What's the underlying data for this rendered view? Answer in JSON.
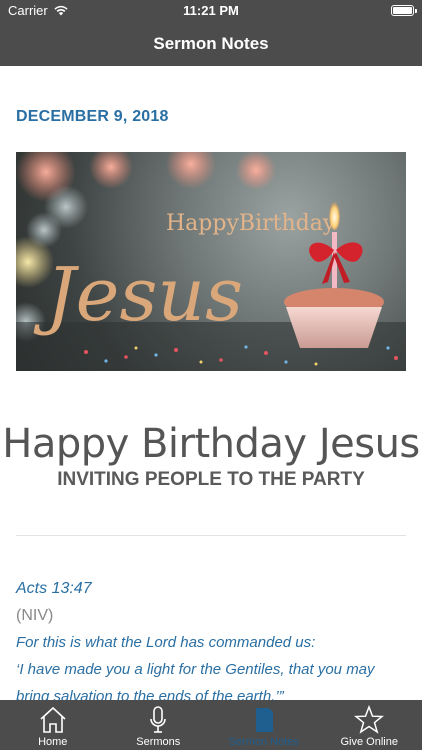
{
  "status_bar": {
    "carrier": "Carrier",
    "time": "11:21 PM"
  },
  "nav": {
    "title": "Sermon Notes"
  },
  "sermon": {
    "date": "DECEMBER 9, 2018",
    "title": "Happy Birthday Jesus",
    "subtitle": "INVITING PEOPLE TO THE PARTY",
    "banner_art_text": "Happy Birthday Jesus",
    "scripture": {
      "reference": "Acts 13:47",
      "version": "(NIV)",
      "lines": [
        "For this is what the Lord has commanded us:",
        "‘I have made you a light for the Gentiles, that you may",
        "bring salvation to the ends of the earth.’”"
      ]
    }
  },
  "tabs": [
    {
      "label": "Home",
      "icon": "home-icon",
      "active": false
    },
    {
      "label": "Sermons",
      "icon": "microphone-icon",
      "active": false
    },
    {
      "label": "Sermon Notes",
      "icon": "notes-icon",
      "active": true
    },
    {
      "label": "Give Online",
      "icon": "star-icon",
      "active": false
    }
  ],
  "colors": {
    "bar": "#4c4c4c",
    "accent": "#2a6fa3",
    "active_tab": "#1f5f8f"
  }
}
